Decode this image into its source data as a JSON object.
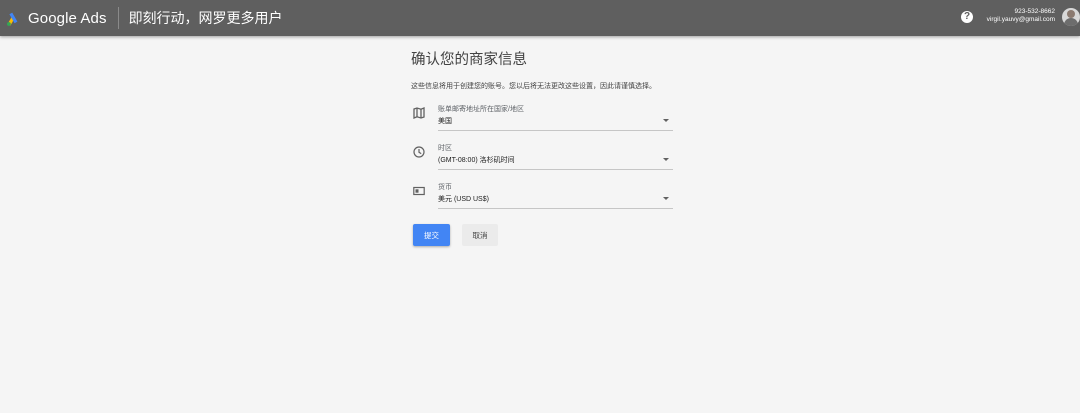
{
  "header": {
    "app_name": "Google Ads",
    "tagline": "即刻行动，网罗更多用户",
    "help_symbol": "?",
    "account_phone": "923-532-8662",
    "account_email": "virgil.yauvy@gmail.com"
  },
  "form": {
    "title": "确认您的商家信息",
    "description": "这些信息将用于创建您的账号。您以后将无法更改这些设置，因此请谨慎选择。",
    "fields": [
      {
        "label": "账单邮寄地址所在国家/地区",
        "value": "美国",
        "icon": "map-icon"
      },
      {
        "label": "时区",
        "value": "(GMT-08:00) 洛杉矶时间",
        "icon": "clock-icon"
      },
      {
        "label": "货币",
        "value": "美元 (USD US$)",
        "icon": "currency-icon"
      }
    ],
    "submit_label": "提交",
    "cancel_label": "取消"
  },
  "colors": {
    "topbar": "#5f5f5f",
    "background": "#f5f5f5",
    "primary": "#4285f4",
    "logo_blue": "#4285f4",
    "logo_yellow": "#fbbc04",
    "logo_green": "#34a853"
  }
}
